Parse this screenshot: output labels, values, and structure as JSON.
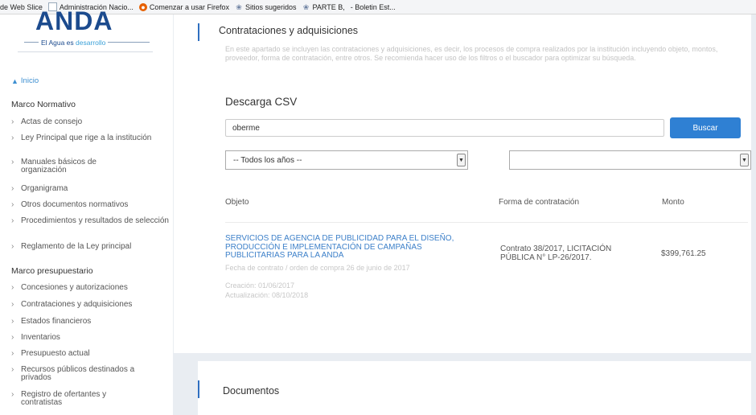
{
  "bookmarks": [
    {
      "label": "de Web Slice",
      "icon": "none"
    },
    {
      "label": "Administración Nacio...",
      "icon": "page-icon"
    },
    {
      "label": "Comenzar a usar Firefox",
      "icon": "firefox-icon"
    },
    {
      "label": "Sitios sugeridos",
      "icon": "globe-icon"
    },
    {
      "label": "PARTE B,",
      "icon": "globe-icon"
    },
    {
      "label": "- Boletin Est...",
      "icon": "none"
    }
  ],
  "logo": {
    "big": "ANDA",
    "tag_pre": "El Agua es ",
    "tag_accent": "desarrollo",
    "color": "#1c4b8e",
    "accent_color": "#3aa0d8"
  },
  "sidebar": {
    "home": "Inicio",
    "section1": "Marco Normativo",
    "items1": [
      "Actas de consejo",
      "Ley Principal que rige a la institución",
      "Manuales básicos de organización",
      "Organigrama",
      "Otros documentos normativos",
      "Procedimientos y resultados de selección",
      "Reglamento de la Ley principal"
    ],
    "section2": "Marco presupuestario",
    "items2": [
      "Concesiones y autorizaciones",
      "Contrataciones y adquisiciones",
      "Estados financieros",
      "Inventarios",
      "Presupuesto actual",
      "Recursos públicos destinados a privados",
      "Registro de ofertantes y contratistas"
    ]
  },
  "main": {
    "title": "Contrataciones y adquisiciones",
    "description": "En este apartado se incluyen las contrataciones y adquisiciones, es decir, los procesos de compra realizados por la institución incluyendo objeto, montos, proveedor, forma de contratación, entre otros. Se recomienda hacer uso de los filtros o el buscador para optimizar su búsqueda.",
    "csv_title": "Descarga CSV",
    "search_value": "oberme",
    "search_button": "Buscar",
    "year_select": "-- Todos los años --",
    "second_select": "",
    "columns": {
      "objeto": "Objeto",
      "forma": "Forma de contratación",
      "monto": "Monto"
    },
    "rows": [
      {
        "objeto": "SERVICIOS DE AGENCIA DE PUBLICIDAD PARA EL DISEÑO, PRODUCCIÓN E IMPLEMENTACIÓN DE CAMPAÑAS PUBLICITARIAS PARA LA ANDA",
        "fecha": "Fecha de contrato / orden de compra 26 de junio de 2017",
        "creacion": "Creación: 01/06/2017",
        "actualizacion": "Actualización: 08/10/2018",
        "forma": "Contrato 38/2017, LICITACIÓN PÚBLICA N° LP-26/2017.",
        "monto": "$399,761.25"
      }
    ]
  },
  "documents": {
    "title": "Documentos"
  },
  "colors": {
    "accent": "#2f6fc0",
    "link": "#3d80c9",
    "button": "#2f80d3",
    "background": "#e9edf2"
  }
}
